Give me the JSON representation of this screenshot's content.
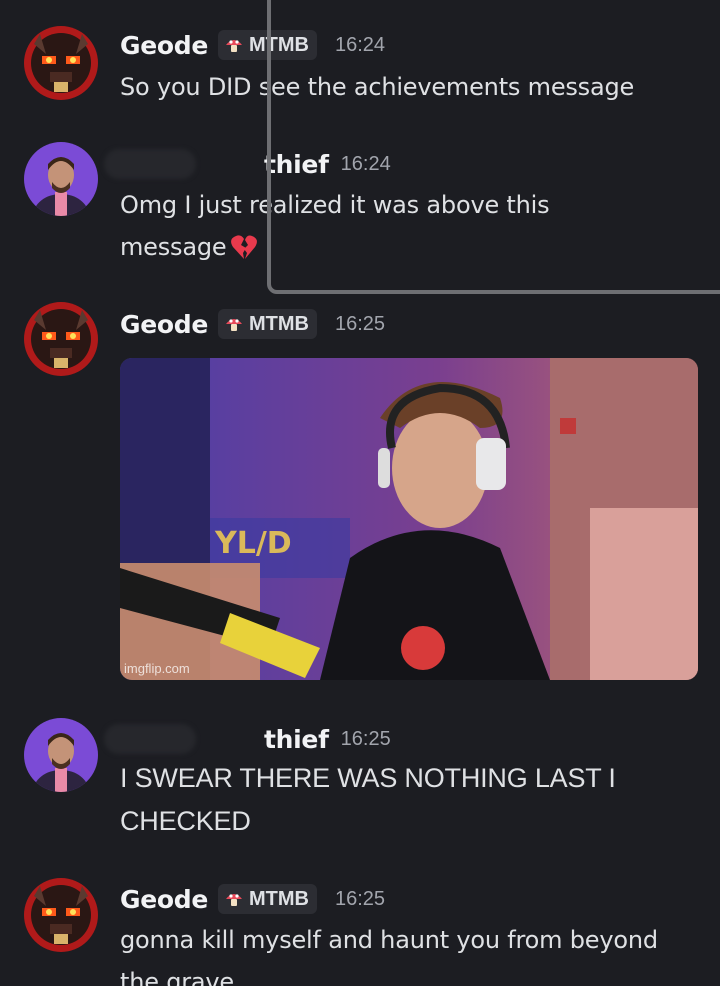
{
  "messages": [
    {
      "author": "Geode",
      "tag": "MTMB",
      "time": "16:24",
      "text": "So you DID see the achievements message"
    },
    {
      "author": "thief",
      "time": "16:24",
      "text": "Omg I just realized it was above this message",
      "emoji": "broken-heart-icon"
    },
    {
      "author": "Geode",
      "tag": "MTMB",
      "time": "16:25",
      "attachment": {
        "type": "gif",
        "credit": "imgflip.com"
      }
    },
    {
      "author": "thief",
      "time": "16:25",
      "text": "I SWEAR THERE WAS NOTHING LAST I CHECKED"
    },
    {
      "author": "Geode",
      "tag": "MTMB",
      "time": "16:25",
      "text": "gonna kill myself and haunt you from beyond the grave"
    }
  ],
  "colors": {
    "background": "#1c1d22",
    "username": "#f2f3f5",
    "timestamp": "#a2a5ad",
    "tag_background": "#2c2d33",
    "overlay_border": "#6e6f73"
  }
}
